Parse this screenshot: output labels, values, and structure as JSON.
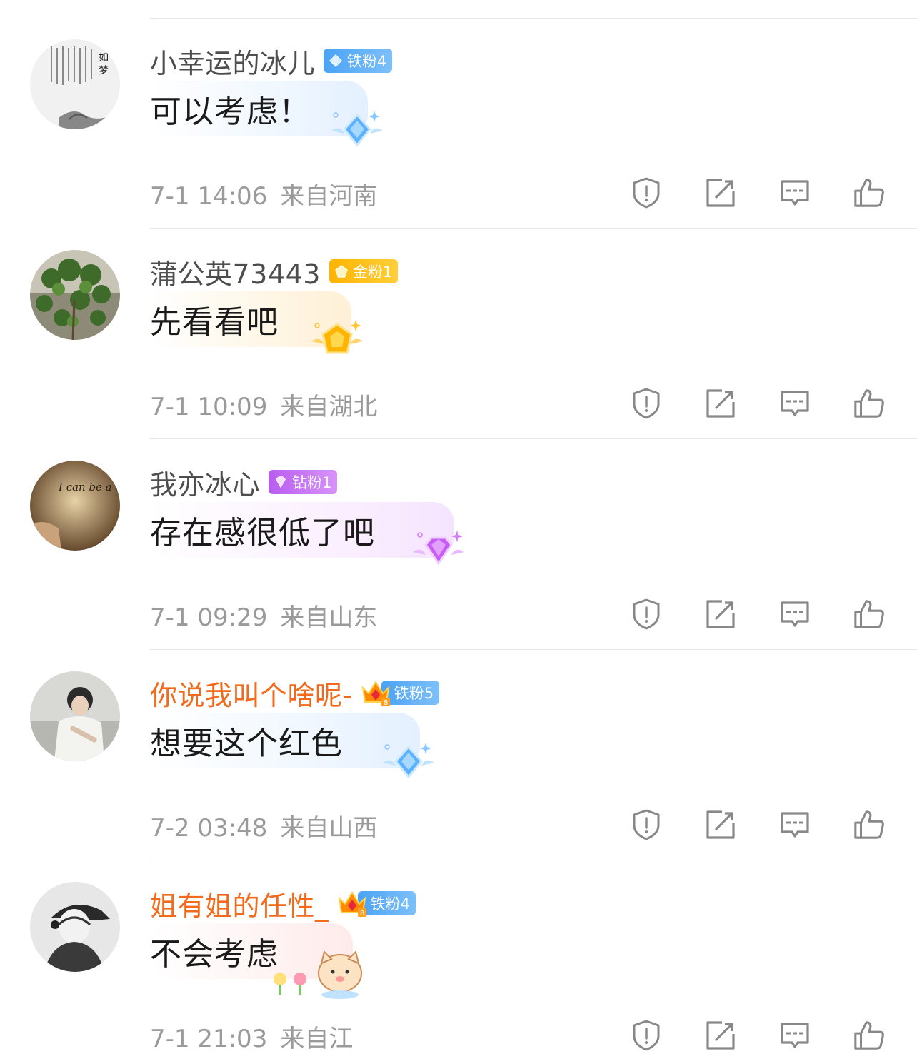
{
  "comments": [
    {
      "username": "小幸运的冰儿",
      "badge": "铁粉4",
      "badge_type": "iron",
      "text": "可以考虑！",
      "date": "7-1 14:06",
      "location": "来自河南",
      "avatar": "ink-painting-calligraphy",
      "bubble_style": "blue-diamond"
    },
    {
      "username": "蒲公英73443",
      "badge": "金粉1",
      "badge_type": "gold",
      "text": "先看看吧",
      "date": "7-1 10:09",
      "location": "来自湖北",
      "avatar": "green-tree-leaves",
      "bubble_style": "gold-gem"
    },
    {
      "username": "我亦冰心",
      "badge": "钻粉1",
      "badge_type": "diamond",
      "text": "存在感很低了吧",
      "date": "7-1 09:29",
      "location": "来自山东",
      "avatar": "handwritten-note",
      "avatar_text": "I can be a better me.",
      "bubble_style": "purple-gem"
    },
    {
      "username": "你说我叫个啥呢-",
      "badge": "铁粉5",
      "badge_type": "iron",
      "vip_crown": true,
      "text": "想要这个红色",
      "date": "7-2 03:48",
      "location": "来自山西",
      "avatar": "person-photo",
      "bubble_style": "blue-diamond"
    },
    {
      "username": "姐有姐的任性_",
      "badge": "铁粉4",
      "badge_type": "iron",
      "vip_crown": true,
      "text": "不会考虑",
      "date": "7-1 21:03",
      "location": "来自江苏",
      "location_visible": "来自江",
      "avatar": "masked-person-cap",
      "bubble_style": "cat-sticker"
    }
  ],
  "actions": [
    "report-icon",
    "share-icon",
    "comment-icon",
    "like-icon"
  ],
  "colors": {
    "vip_name": "#f26b1d",
    "name": "#4d4d4d",
    "meta": "#9a9a9a",
    "iron_badge": "#4aa3f5",
    "gold_badge": "#ffb400",
    "diamond_badge": "#b85cf0"
  }
}
